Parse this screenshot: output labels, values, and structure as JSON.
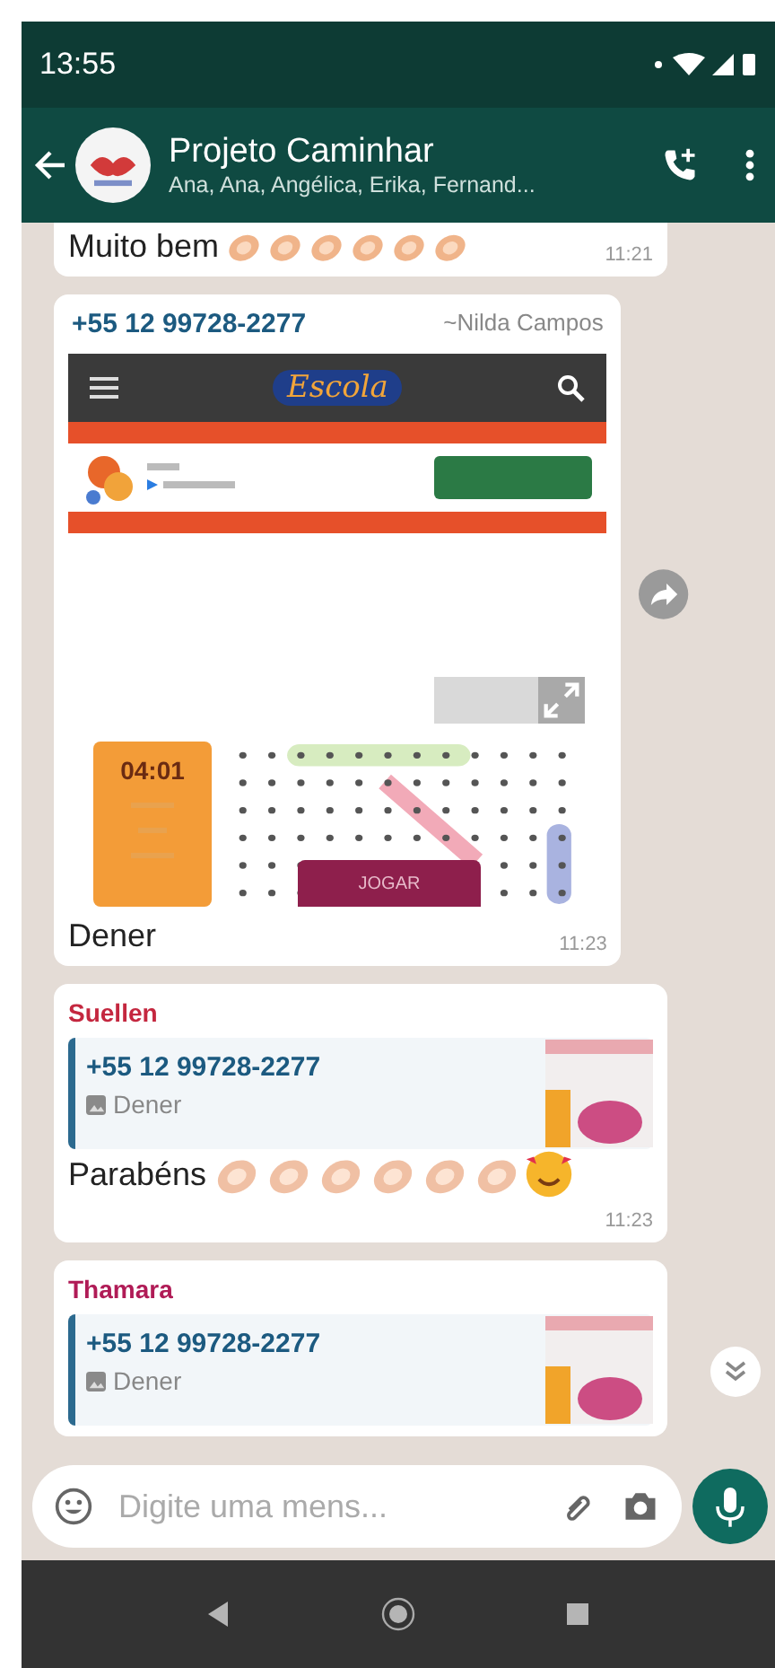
{
  "status_bar": {
    "time": "13:55"
  },
  "header": {
    "title": "Projeto Caminhar",
    "subtitle": "Ana, Ana, Angélica, Erika, Fernand..."
  },
  "messages": [
    {
      "kind": "text",
      "text": "Muito bem",
      "time": "11:21"
    },
    {
      "sender": "+55 12 99728-2277",
      "sender_name": "~Nilda Campos",
      "shot": {
        "logo": "Escola",
        "timer": "04:01",
        "button": "JOGAR"
      },
      "caption": "Dener",
      "time": "11:23"
    },
    {
      "kind": "reply",
      "sender": "Suellen",
      "color": "#c4273f",
      "quote": {
        "author": "+55 12 99728-2277",
        "text": "Dener"
      },
      "text": "Parabéns",
      "time": "11:23"
    },
    {
      "kind": "reply",
      "sender": "Thamara",
      "color": "#b01b56",
      "quote": {
        "author": "+55 12 99728-2277",
        "text": "Dener"
      }
    }
  ],
  "composer": {
    "placeholder": "Digite uma mens..."
  }
}
